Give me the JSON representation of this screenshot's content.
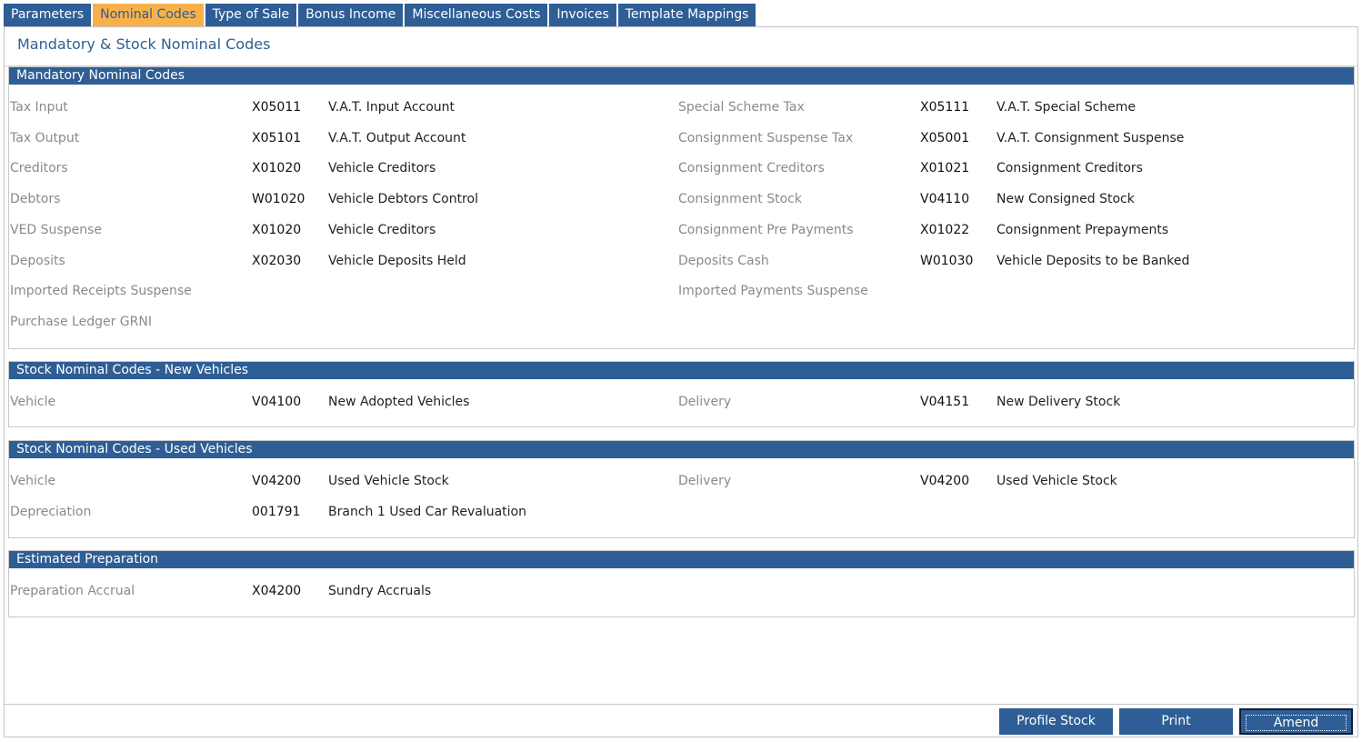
{
  "tabs": [
    {
      "label": "Parameters"
    },
    {
      "label": "Nominal Codes"
    },
    {
      "label": "Type of Sale"
    },
    {
      "label": "Bonus Income"
    },
    {
      "label": "Miscellaneous Costs"
    },
    {
      "label": "Invoices"
    },
    {
      "label": "Template Mappings"
    }
  ],
  "active_tab": "Nominal Codes",
  "page_title": "Mandatory & Stock Nominal Codes",
  "sections": {
    "mandatory": {
      "title": "Mandatory Nominal Codes",
      "rows": [
        {
          "left": {
            "label": "Tax Input",
            "code": "X05011",
            "desc": "V.A.T. Input Account"
          },
          "right": {
            "label": "Special Scheme Tax",
            "code": "X05111",
            "desc": "V.A.T. Special Scheme"
          }
        },
        {
          "left": {
            "label": "Tax Output",
            "code": "X05101",
            "desc": "V.A.T. Output Account"
          },
          "right": {
            "label": "Consignment Suspense Tax",
            "code": "X05001",
            "desc": "V.A.T. Consignment Suspense"
          }
        },
        {
          "left": {
            "label": "Creditors",
            "code": "X01020",
            "desc": "Vehicle Creditors"
          },
          "right": {
            "label": "Consignment Creditors",
            "code": "X01021",
            "desc": "Consignment Creditors"
          }
        },
        {
          "left": {
            "label": "Debtors",
            "code": "W01020",
            "desc": "Vehicle Debtors Control"
          },
          "right": {
            "label": "Consignment Stock",
            "code": "V04110",
            "desc": "New Consigned Stock"
          }
        },
        {
          "left": {
            "label": "VED Suspense",
            "code": "X01020",
            "desc": "Vehicle Creditors"
          },
          "right": {
            "label": "Consignment Pre Payments",
            "code": "X01022",
            "desc": "Consignment Prepayments"
          }
        },
        {
          "left": {
            "label": "Deposits",
            "code": "X02030",
            "desc": "Vehicle Deposits Held"
          },
          "right": {
            "label": "Deposits Cash",
            "code": "W01030",
            "desc": "Vehicle Deposits to be Banked"
          }
        },
        {
          "left": {
            "label": "Imported Receipts Suspense",
            "code": "",
            "desc": ""
          },
          "right": {
            "label": "Imported Payments Suspense",
            "code": "",
            "desc": ""
          }
        },
        {
          "left": {
            "label": "Purchase Ledger GRNI",
            "code": "",
            "desc": ""
          },
          "right": {
            "label": "",
            "code": "",
            "desc": ""
          }
        }
      ]
    },
    "new_vehicles": {
      "title": "Stock Nominal Codes - New Vehicles",
      "rows": [
        {
          "left": {
            "label": "Vehicle",
            "code": "V04100",
            "desc": "New Adopted Vehicles"
          },
          "right": {
            "label": "Delivery",
            "code": "V04151",
            "desc": "New Delivery Stock"
          }
        }
      ]
    },
    "used_vehicles": {
      "title": "Stock Nominal Codes - Used Vehicles",
      "rows": [
        {
          "left": {
            "label": "Vehicle",
            "code": "V04200",
            "desc": "Used Vehicle Stock"
          },
          "right": {
            "label": "Delivery",
            "code": "V04200",
            "desc": "Used Vehicle Stock"
          }
        },
        {
          "left": {
            "label": "Depreciation",
            "code": "001791",
            "desc": "Branch 1 Used Car Revaluation"
          },
          "right": {
            "label": "",
            "code": "",
            "desc": ""
          }
        }
      ]
    },
    "estimated_prep": {
      "title": "Estimated Preparation",
      "rows": [
        {
          "left": {
            "label": "Preparation Accrual",
            "code": "X04200",
            "desc": "Sundry Accruals"
          },
          "right": {
            "label": "",
            "code": "",
            "desc": ""
          }
        }
      ]
    }
  },
  "buttons": {
    "profile_stock": "Profile Stock",
    "print": "Print",
    "amend": "Amend"
  },
  "colors": {
    "accent": "#2e5e95",
    "active_tab": "#f7b04a"
  }
}
